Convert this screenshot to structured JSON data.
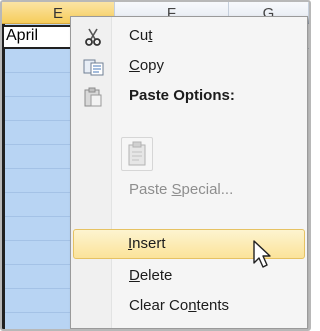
{
  "sheet": {
    "columns": [
      "E",
      "F",
      "G"
    ],
    "selected_column": "E",
    "cell_value": "April"
  },
  "context_menu": {
    "items": [
      {
        "key": "cut",
        "pre": "Cu",
        "accel": "t",
        "post": "",
        "icon": "scissors-icon",
        "disabled": false
      },
      {
        "key": "copy",
        "pre": "",
        "accel": "C",
        "post": "opy",
        "icon": "copy-icon",
        "disabled": false
      },
      {
        "key": "paste_options",
        "text": "Paste Options:",
        "icon": "clipboard-icon"
      },
      {
        "key": "paste_special",
        "pre": "Paste ",
        "accel": "S",
        "post": "pecial...",
        "disabled": true
      },
      {
        "key": "insert",
        "pre": "",
        "accel": "I",
        "post": "nsert",
        "disabled": false,
        "highlighted": true
      },
      {
        "key": "delete",
        "pre": "",
        "accel": "D",
        "post": "elete",
        "disabled": false
      },
      {
        "key": "clear",
        "pre": "Clear Co",
        "accel": "n",
        "post": "tents",
        "disabled": false
      }
    ]
  },
  "colors": {
    "column_selection": "#b8d4f3",
    "menu_highlight": "#fbe39a",
    "menu_background": "#f5f5f5"
  }
}
